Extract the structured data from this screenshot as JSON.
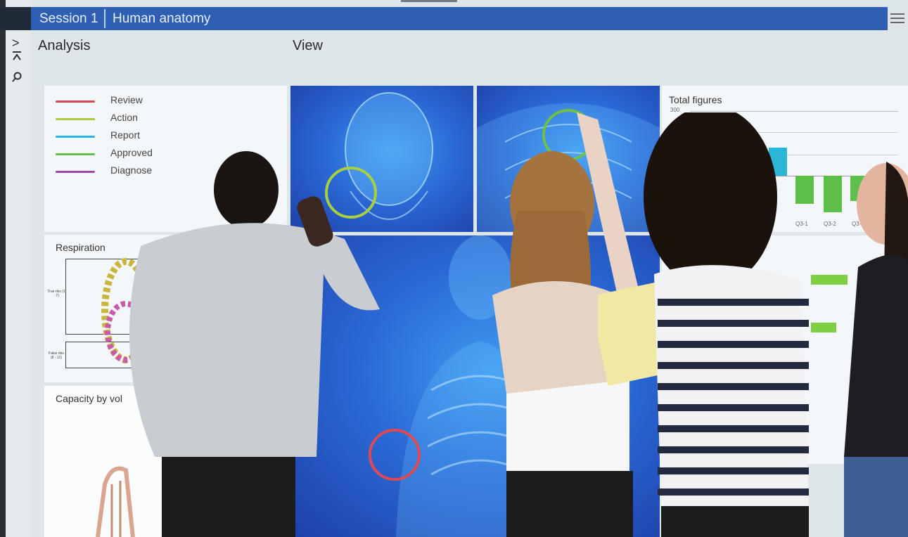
{
  "header": {
    "session_tab": "Session 1",
    "title_tab": "Human anatomy",
    "menu_icon": "hamburger-menu-icon"
  },
  "toolbar_left": {
    "icons": [
      "chevron-right-icon",
      "collapse-up-icon",
      "search-icon"
    ]
  },
  "sections": {
    "analysis": "Analysis",
    "view": "View"
  },
  "legend": [
    {
      "label": "Review",
      "color": "#d64a55"
    },
    {
      "label": "Action",
      "color": "#a8cc3a"
    },
    {
      "label": "Report",
      "color": "#27b7e0"
    },
    {
      "label": "Approved",
      "color": "#5fc046"
    },
    {
      "label": "Diagnose",
      "color": "#9b4aa8"
    }
  ],
  "panels": {
    "respiration": {
      "title": "Respiration",
      "label_true": "True ribs (1 - 7)",
      "label_false": "False ribs (8 - 12)"
    },
    "capacity": {
      "title": "Capacity by vol"
    },
    "total_figures": {
      "title": "Total figures",
      "axis_top": "300",
      "x_ticks": [
        "Q3-1",
        "Q3-2",
        "Q3-"
      ],
      "bar_colors": {
        "positive": "#2bb5d8",
        "negative": "#5cc04a"
      }
    }
  },
  "annotations": {
    "circle_colors": {
      "green": "#a9cf3f",
      "red": "#e04952"
    }
  }
}
